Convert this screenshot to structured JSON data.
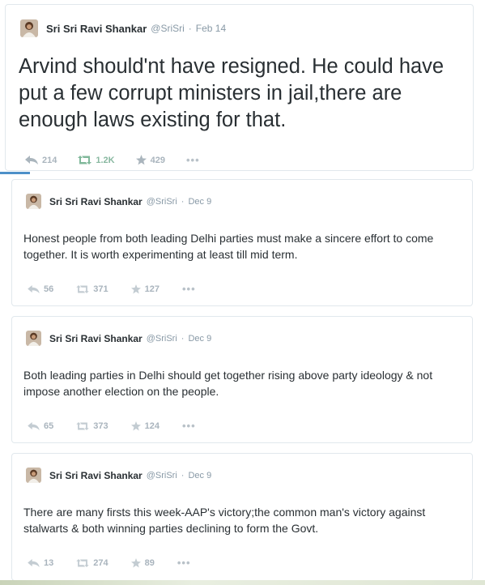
{
  "colors": {
    "card_border": "#e1e8ed",
    "text": "#292f33",
    "muted": "#8899a6",
    "action": "#a9b4bd",
    "retweet": "#88b8a0",
    "accent_blue": "#4d90c8"
  },
  "tweets": [
    {
      "name": "Sri Sri Ravi Shankar",
      "handle": "@SriSri",
      "separator": "·",
      "date": "Feb 14",
      "text": "Arvind should'nt have resigned. He could have put a few corrupt ministers in jail,there are enough laws existing for that.",
      "replies": "214",
      "retweets": "1.2K",
      "favorites": "429",
      "more": "•••",
      "icons": [
        "reply-icon",
        "retweet-icon",
        "favorite-star-icon",
        "more-icon"
      ]
    },
    {
      "name": "Sri Sri Ravi Shankar",
      "handle": "@SriSri",
      "separator": "·",
      "date": "Dec 9",
      "text": "Honest people from both leading Delhi parties must make a sincere effort to come together. It is worth experimenting at least till mid term.",
      "replies": "56",
      "retweets": "371",
      "favorites": "127",
      "more": "•••"
    },
    {
      "name": "Sri Sri Ravi Shankar",
      "handle": "@SriSri",
      "separator": "·",
      "date": "Dec 9",
      "text": "Both leading parties in Delhi should get together rising above party ideology & not impose another election on the people.",
      "replies": "65",
      "retweets": "373",
      "favorites": "124",
      "more": "•••"
    },
    {
      "name": "Sri Sri Ravi Shankar",
      "handle": "@SriSri",
      "separator": "·",
      "date": "Dec 9",
      "text": "There are many firsts this week-AAP's victory;the common man's victory against stalwarts & both winning parties declining to form the Govt.",
      "replies": "13",
      "retweets": "274",
      "favorites": "89",
      "more": "•••"
    }
  ]
}
